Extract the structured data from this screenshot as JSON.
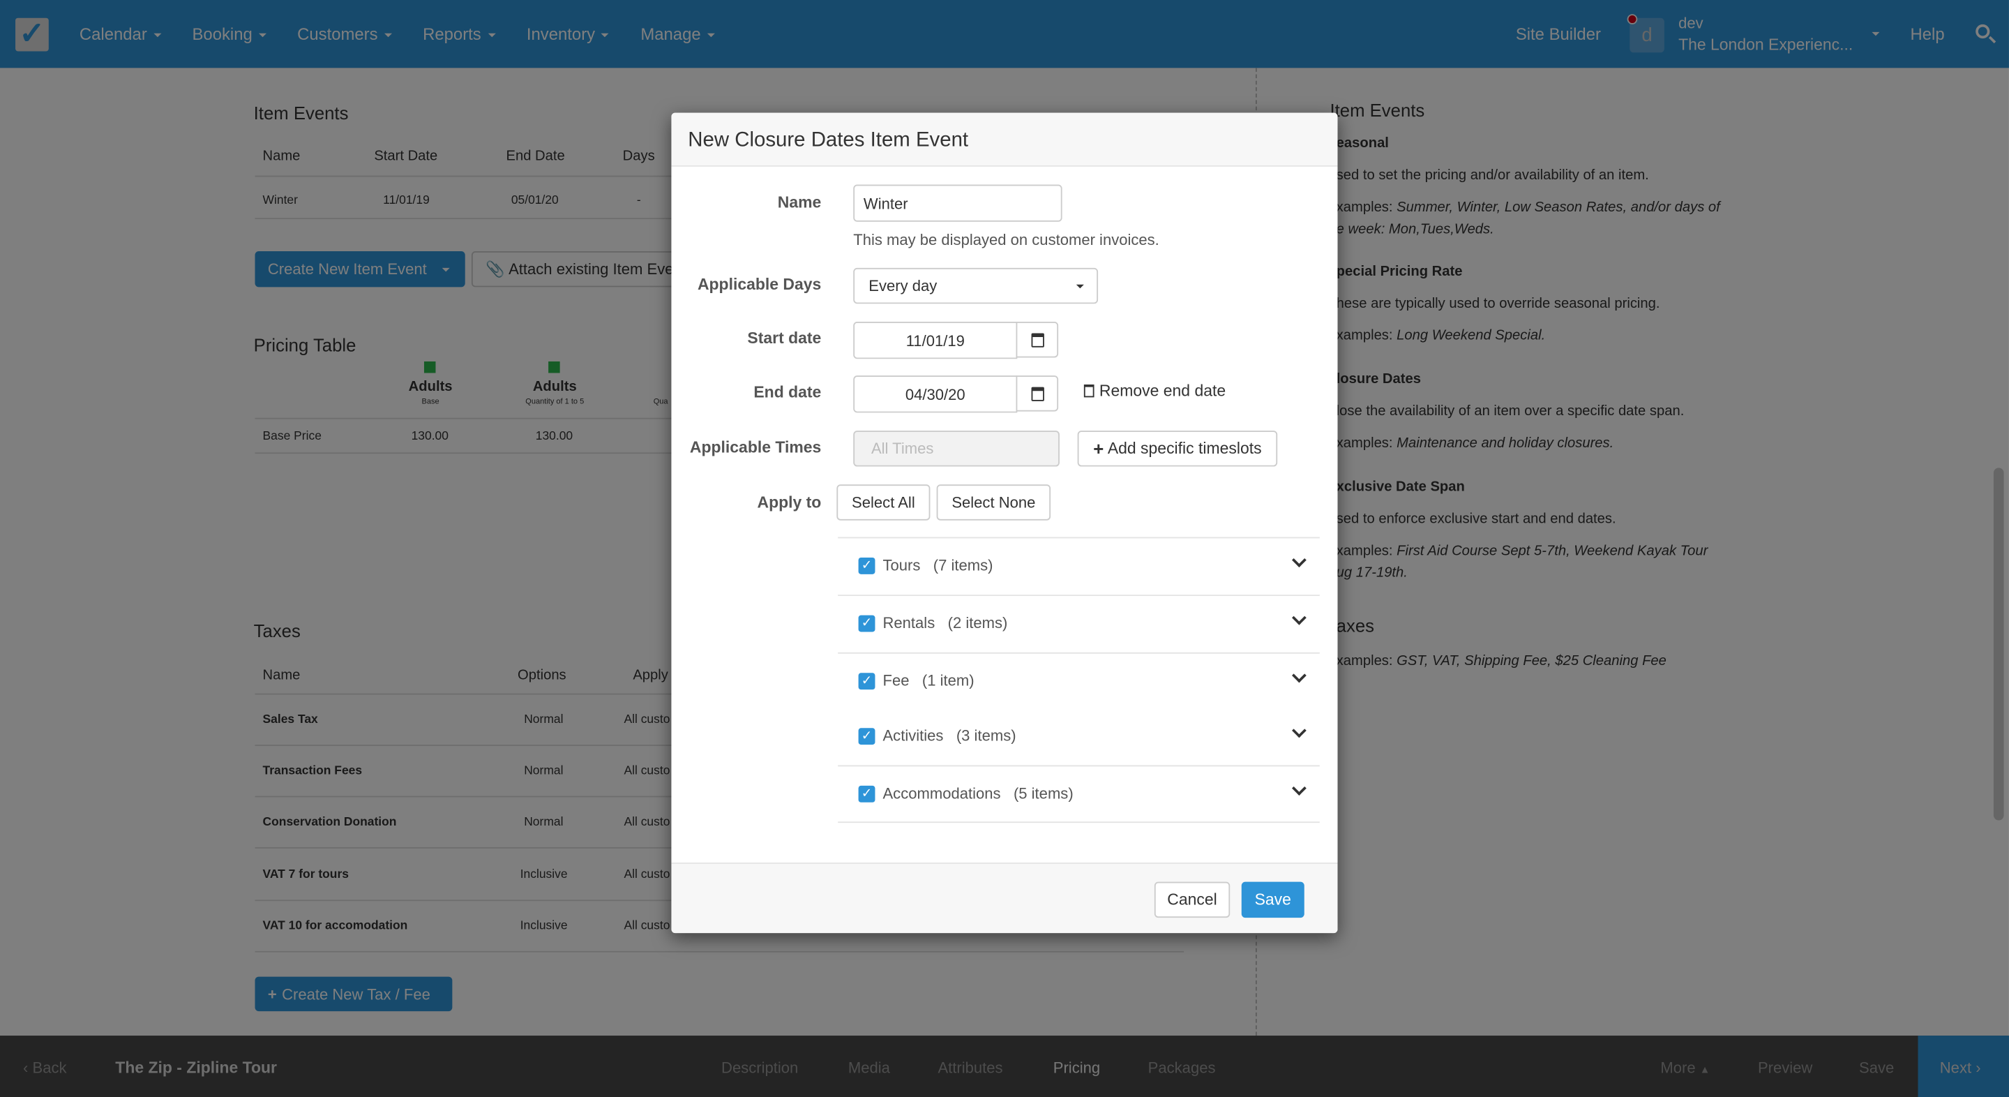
{
  "colors": {
    "accent": "#2e94d8",
    "nav": "#2e94d8",
    "footer_bar": "#484848",
    "pricing_marker": "#2db84d",
    "notification": "#d0021b"
  },
  "nav": {
    "menu": [
      "Calendar",
      "Booking",
      "Customers",
      "Reports",
      "Inventory",
      "Manage"
    ],
    "site_builder": "Site Builder",
    "avatar_letter": "d",
    "user": "dev",
    "company": "The London Experienc...",
    "help": "Help"
  },
  "item_events": {
    "title": "Item Events",
    "columns": [
      "Name",
      "Start Date",
      "End Date",
      "Days"
    ],
    "rows": [
      [
        "Winter",
        "11/01/19",
        "05/01/20",
        "-"
      ]
    ],
    "create_button": "Create New Item Event",
    "attach_button": "Attach existing Item Eve"
  },
  "pricing": {
    "title": "Pricing Table",
    "columns": [
      {
        "name": "Adults",
        "sub": "Base"
      },
      {
        "name": "Adults",
        "sub": "Quantity of 1 to 5"
      },
      {
        "name": "",
        "sub": "Qua"
      }
    ],
    "rows": [
      {
        "label": "Base Price",
        "values": [
          "130.00",
          "130.00"
        ]
      }
    ]
  },
  "taxes": {
    "title": "Taxes",
    "columns": [
      "Name",
      "Options",
      "Apply"
    ],
    "rows": [
      [
        "Sales Tax",
        "Normal",
        "All custo"
      ],
      [
        "Transaction Fees",
        "Normal",
        "All custo"
      ],
      [
        "Conservation Donation",
        "Normal",
        "All custo"
      ],
      [
        "VAT 7 for tours",
        "Inclusive",
        "All custo"
      ],
      [
        "VAT 10 for accomodation",
        "Inclusive",
        "All custo"
      ]
    ],
    "create_button": "Create New Tax / Fee"
  },
  "help": {
    "title": "Item Events",
    "sections": [
      {
        "heading": "easonal",
        "text": "sed to set the pricing and/or availability of an item.",
        "ex_prefix": "xamples: ",
        "ex": "Summer, Winter, Low Season Rates, and/or days of",
        "ex2": "e week: Mon,Tues,Weds."
      },
      {
        "heading": "pecial Pricing Rate",
        "text": "hese are typically used to override seasonal pricing.",
        "ex_prefix": "xamples: ",
        "ex": "Long Weekend Special."
      },
      {
        "heading": "losure Dates",
        "text": "lose the availability of an item over a specific date span.",
        "ex_prefix": "xamples: ",
        "ex": "Maintenance and holiday closures."
      },
      {
        "heading": "xclusive Date Span",
        "text": "sed to enforce exclusive start and end dates.",
        "ex_prefix": "xamples: ",
        "ex": "First Aid Course Sept 5-7th, Weekend Kayak Tour",
        "ex2": "ug 17-19th."
      },
      {
        "heading": "axes",
        "ex_prefix": "xamples: ",
        "ex": "GST, VAT, Shipping Fee, $25 Cleaning Fee"
      }
    ]
  },
  "bottom": {
    "back": "Back",
    "item_title": "The Zip - Zipline Tour",
    "tabs": [
      "Description",
      "Media",
      "Attributes",
      "Pricing",
      "Packages"
    ],
    "active_tab": "Pricing",
    "more": "More",
    "preview": "Preview",
    "save": "Save",
    "next": "Next"
  },
  "modal": {
    "title": "New Closure Dates Item Event",
    "name_label": "Name",
    "name_value": "Winter",
    "name_help": "This may be displayed on customer invoices.",
    "days_label": "Applicable Days",
    "days_value": "Every day",
    "start_label": "Start date",
    "start_value": "11/01/19",
    "end_label": "End date",
    "end_value": "04/30/20",
    "remove_end": "Remove end date",
    "times_label": "Applicable Times",
    "times_placeholder": "All Times",
    "add_timeslots": "Add specific timeslots",
    "apply_label": "Apply to",
    "select_all": "Select All",
    "select_none": "Select None",
    "categories": [
      {
        "name": "Tours",
        "count": "(7 items)",
        "checked": true
      },
      {
        "name": "Rentals",
        "count": "(2 items)",
        "checked": true
      },
      {
        "name": "Fee",
        "count": "(1 item)",
        "checked": true
      },
      {
        "name": "Activities",
        "count": "(3 items)",
        "checked": true
      },
      {
        "name": "Accommodations",
        "count": "(5 items)",
        "checked": true
      }
    ],
    "cancel": "Cancel",
    "save": "Save"
  }
}
